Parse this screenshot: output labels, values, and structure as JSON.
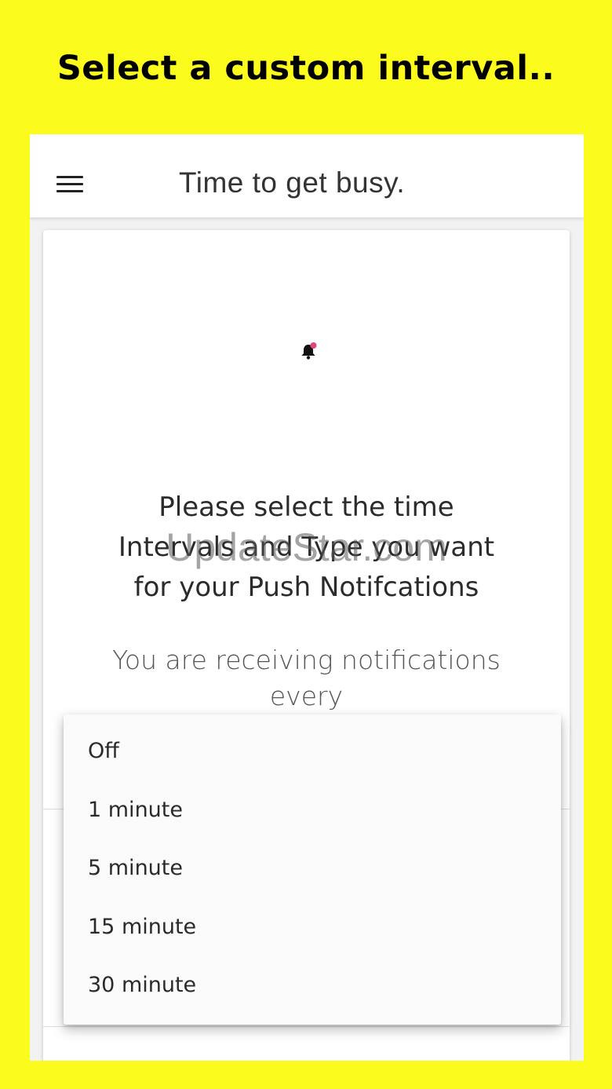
{
  "banner": {
    "headline": "Select a custom interval.."
  },
  "appbar": {
    "title": "Time to get busy.",
    "menu_icon": "hamburger-menu-icon"
  },
  "card": {
    "bell_icon": "notification-bell-icon",
    "prompt_lines": [
      "Please select the time",
      "Intervals and Type you want",
      "for your Push Notifcations"
    ],
    "watermark": "UpdateStar.com",
    "status_lines": [
      "You are receiving notifications",
      "every"
    ]
  },
  "dropdown": {
    "options": [
      "Off",
      "1 minute",
      "5 minute",
      "15 minute",
      "30 minute"
    ]
  },
  "colors": {
    "background": "#FBFC1D",
    "bell_badge": "#E0457B"
  }
}
